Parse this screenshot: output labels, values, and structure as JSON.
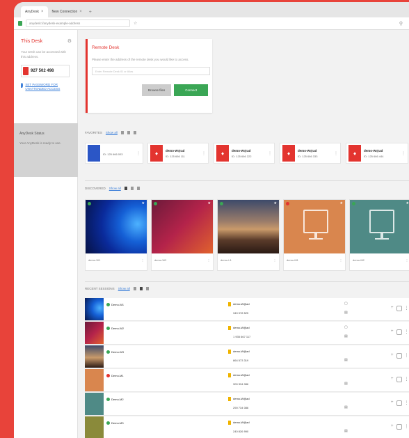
{
  "browser": {
    "tabs": [
      {
        "label": "AnyDesk",
        "close": "×"
      },
      {
        "label": "New Connection",
        "close": "×"
      }
    ],
    "new_tab": "+",
    "window_controls": "–",
    "url": "anydesk://anydesk-example-address",
    "addr_icons": [
      "⚲",
      "⋮"
    ]
  },
  "left_panel": {
    "this_desk": {
      "title": "This Desk",
      "text": "Your Desk can be accessed with this address.",
      "id": "927 502 498",
      "link": "SET PASSWORD FOR UNATTENDED ACCESS"
    },
    "status": {
      "title": "AnyDesk Status",
      "text": "Your AnyDesk is ready to use."
    }
  },
  "remote_desk": {
    "title": "Remote Desk",
    "text": "Please enter the address of the remote desk you would like to access.",
    "placeholder": "Enter Remote Desk ID or Alias",
    "browse_label": "Browse files",
    "connect_label": "Connect"
  },
  "sections": {
    "favorites": {
      "label": "FAVORITES",
      "link": "Show all"
    },
    "discovered": {
      "label": "DISCOVERED",
      "link": "Show all"
    },
    "recent": {
      "label": "RECENT SESSIONS",
      "link": "Show all"
    }
  },
  "favorites": [
    {
      "name": "",
      "id": "ID: 125 666 003"
    },
    {
      "name": "demo-W@ad",
      "id": "ID: 125 666 111"
    },
    {
      "name": "demo-W@ad",
      "id": "ID: 125 666 222"
    },
    {
      "name": "demo-W@ad",
      "id": "ID: 125 666 333"
    },
    {
      "name": "demo-W@ad",
      "id": "ID: 125 666 444"
    }
  ],
  "discovered": [
    {
      "label": "demo-W1",
      "status": "online"
    },
    {
      "label": "demo-W2",
      "status": "online"
    },
    {
      "label": "demo-L1",
      "status": "online"
    },
    {
      "label": "demo-M1",
      "status": "offline"
    },
    {
      "label": "demo-M2",
      "status": "online"
    }
  ],
  "recent": [
    {
      "name": "Demo-W1",
      "user": "demo-W@ad",
      "id": "349 978 525",
      "status": "online"
    },
    {
      "name": "Demo-W2",
      "user": "demo-W@ad",
      "id": "1 935 667 117",
      "status": "online"
    },
    {
      "name": "Demo-W3",
      "user": "demo-W@ad",
      "id": "864 573 319",
      "status": "online"
    },
    {
      "name": "Demo-M1",
      "user": "demo-W@ad",
      "id": "300 334 086",
      "status": "offline"
    },
    {
      "name": "Demo-M2",
      "user": "demo-W@ad",
      "id": "290 734 086",
      "status": "online"
    },
    {
      "name": "Demo-M3",
      "user": "demo-W@ad",
      "id": "240 826 990",
      "status": "online"
    }
  ],
  "colors": {
    "accent": "#e3342f",
    "connect": "#3aa655",
    "online": "#3aa655",
    "offline": "#e3342f",
    "background": "#e8433a"
  }
}
